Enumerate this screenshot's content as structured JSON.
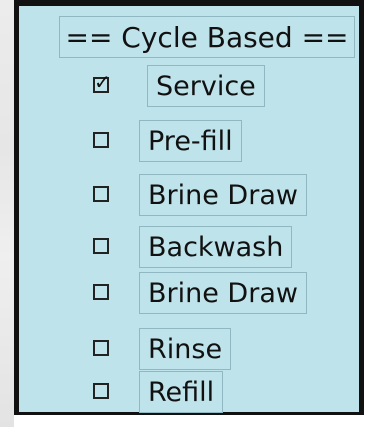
{
  "section": {
    "title": "== Cycle Based =="
  },
  "items": [
    {
      "label": "Service",
      "checked": true
    },
    {
      "label": "Pre-fill",
      "checked": false
    },
    {
      "label": "Brine Draw",
      "checked": false
    },
    {
      "label": "Backwash",
      "checked": false
    },
    {
      "label": "Brine Draw",
      "checked": false
    },
    {
      "label": "Rinse",
      "checked": false
    },
    {
      "label": "Refill",
      "checked": false
    }
  ]
}
